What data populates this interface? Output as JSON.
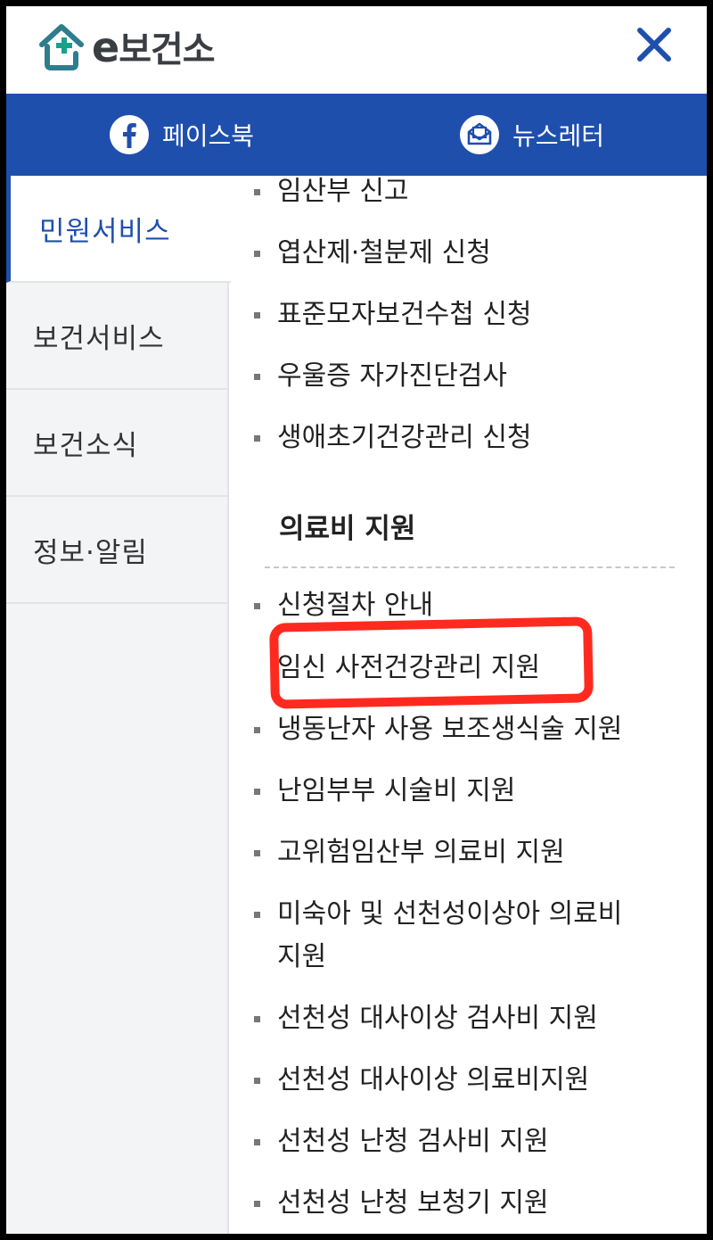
{
  "header": {
    "logo_text": "보건소",
    "logo_e": "e",
    "close_label": "close"
  },
  "social": {
    "facebook_label": "페이스북",
    "newsletter_label": "뉴스레터"
  },
  "sidebar": {
    "items": [
      {
        "label": "민원서비스",
        "active": true
      },
      {
        "label": "보건서비스",
        "active": false
      },
      {
        "label": "보건소식",
        "active": false
      },
      {
        "label": "정보·알림",
        "active": false
      }
    ]
  },
  "content": {
    "top_items": [
      "임산부 신고",
      "엽산제·철분제 신청",
      "표준모자보건수첩 신청",
      "우울증 자가진단검사",
      "생애초기건강관리 신청"
    ],
    "section_title": "의료비 지원",
    "section_items": [
      "신청절차 안내",
      "임신 사전건강관리 지원",
      "냉동난자 사용 보조생식술 지원",
      "난임부부 시술비 지원",
      "고위험임산부 의료비 지원",
      "미숙아 및 선천성이상아 의료비 지원",
      "선천성 대사이상 검사비 지원",
      "선천성 대사이상 의료비지원",
      "선천성 난청 검사비 지원",
      "선천성 난청 보청기 지원"
    ]
  },
  "colors": {
    "brand_blue": "#1f4fad",
    "highlight_red": "#ff2a1f",
    "logo_green": "#1aa08b"
  }
}
